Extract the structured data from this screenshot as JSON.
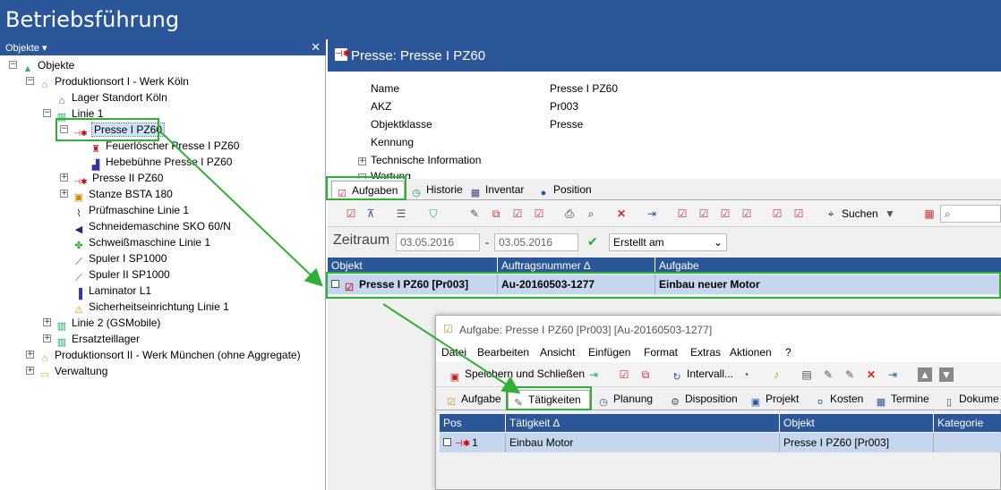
{
  "window": {
    "title": "Betriebsführung"
  },
  "left": {
    "header": "Objekte ▾",
    "close": "✕",
    "tree": [
      {
        "label": "Objekte",
        "level": 0,
        "icon": "objects-icon"
      },
      {
        "label": "Produktionsort I - Werk Köln",
        "level": 1,
        "icon": "site-icon"
      },
      {
        "label": "Lager Standort Köln",
        "level": 2,
        "icon": "warehouse-icon"
      },
      {
        "label": "Linie 1",
        "level": 2,
        "icon": "line-icon"
      },
      {
        "label": "Presse I PZ60",
        "level": 3,
        "icon": "press-icon",
        "selected": true
      },
      {
        "label": "Feuerlöscher Presse I PZ60",
        "level": 4,
        "icon": "extinguisher-icon"
      },
      {
        "label": "Hebebühne Presse I PZ60",
        "level": 4,
        "icon": "lift-icon"
      },
      {
        "label": "Presse II PZ60",
        "level": 3,
        "icon": "press-icon"
      },
      {
        "label": "Stanze BSTA 180",
        "level": 3,
        "icon": "punch-icon"
      },
      {
        "label": "Prüfmaschine Linie 1",
        "level": 3,
        "icon": "tester-icon"
      },
      {
        "label": "Schneidemaschine SKO 60/N",
        "level": 3,
        "icon": "cutter-icon"
      },
      {
        "label": "Schweißmaschine Linie 1",
        "level": 3,
        "icon": "welder-icon"
      },
      {
        "label": "Spuler I SP1000",
        "level": 3,
        "icon": "spooler-icon"
      },
      {
        "label": "Spuler II SP1000",
        "level": 3,
        "icon": "spooler-icon"
      },
      {
        "label": "Laminator L1",
        "level": 3,
        "icon": "laminator-icon"
      },
      {
        "label": "Sicherheitseinrichtung Linie 1",
        "level": 3,
        "icon": "warning-icon"
      },
      {
        "label": "Linie 2 (GSMobile)",
        "level": 2,
        "icon": "line-icon"
      },
      {
        "label": "Ersatzteillager",
        "level": 2,
        "icon": "line-icon"
      },
      {
        "label": "Produktionsort II - Werk München (ohne Aggregate)",
        "level": 1,
        "icon": "site-icon"
      },
      {
        "label": "Verwaltung",
        "level": 1,
        "icon": "folder-icon"
      }
    ]
  },
  "object": {
    "title": "Presse: Presse I PZ60",
    "props": [
      {
        "label": "Name",
        "value": "Presse I PZ60"
      },
      {
        "label": "AKZ",
        "value": "Pr003"
      },
      {
        "label": "Objektklasse",
        "value": "Presse"
      },
      {
        "label": "Kennung",
        "value": ""
      }
    ],
    "groups": [
      "Technische Information",
      "Wartung"
    ]
  },
  "tabs1": [
    "Aufgaben",
    "Historie",
    "Inventar",
    "Position"
  ],
  "toolbar1": {
    "search": "Suchen"
  },
  "zeitraum": {
    "label": "Zeitraum",
    "from": "03.05.2016",
    "to": "03.05.2016",
    "sep": "-",
    "field": "Erstellt am"
  },
  "grid1": {
    "columns": [
      "Objekt",
      "Auftragsnummer",
      "Aufgabe"
    ],
    "sort_mark": "∆",
    "row": {
      "objekt": "Presse I PZ60 [Pr003]",
      "auftrag": "Au-20160503-1277",
      "aufgabe": "Einbau neuer Motor"
    }
  },
  "dialog": {
    "title": "Aufgabe: Presse I PZ60 [Pr003] [Au-20160503-1277]",
    "menu": [
      "Datei",
      "Bearbeiten",
      "Ansicht",
      "Einfügen",
      "Format",
      "Extras",
      "Aktionen",
      "?"
    ],
    "save": "Speichern und Schließen",
    "interval": "Intervall...",
    "tabs": [
      "Aufgabe",
      "Tätigkeiten",
      "Planung",
      "Disposition",
      "Projekt",
      "Kosten",
      "Termine",
      "Dokume"
    ],
    "columns": [
      "Pos",
      "Tätigkeit",
      "Objekt",
      "Kategorie"
    ],
    "sort_mark": "∆",
    "row": {
      "pos": "1",
      "taetigkeit": "Einbau Motor",
      "objekt": "Presse I PZ60 [Pr003]",
      "kategorie": ""
    }
  },
  "colors": {
    "accent": "#2b579a",
    "highlight": "#2eb135",
    "selection": "#c6d6ef"
  }
}
